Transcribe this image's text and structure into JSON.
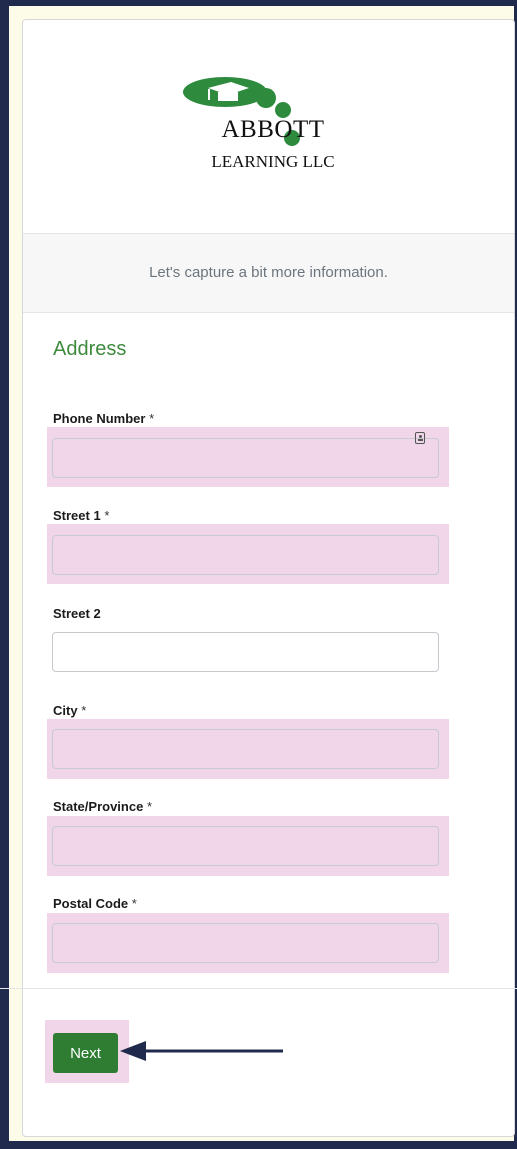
{
  "logo": {
    "name": "ABBOTT",
    "sub": "LEARNING LLC",
    "brand_green": "#2e8b3e",
    "icon": "graduation-cap-icon"
  },
  "info": {
    "text": "Let's capture a bit more information."
  },
  "form": {
    "section_title": "Address",
    "fields": [
      {
        "label": "Phone Number",
        "required_mark": "*",
        "value": ""
      },
      {
        "label": "Street 1",
        "required_mark": "*",
        "value": ""
      },
      {
        "label": "Street 2",
        "required_mark": "",
        "value": ""
      },
      {
        "label": "City",
        "required_mark": "*",
        "value": ""
      },
      {
        "label": "State/Province",
        "required_mark": "*",
        "value": ""
      },
      {
        "label": "Postal Code",
        "required_mark": "*",
        "value": ""
      }
    ],
    "contact_icon": "contact-card-icon"
  },
  "actions": {
    "next_label": "Next",
    "pointer_icon": "arrow-left-icon"
  },
  "colors": {
    "frame": "#1f2a4c",
    "highlight": "#f0d6e8",
    "button": "#2e7d32",
    "title_green": "#3e8b3e"
  }
}
